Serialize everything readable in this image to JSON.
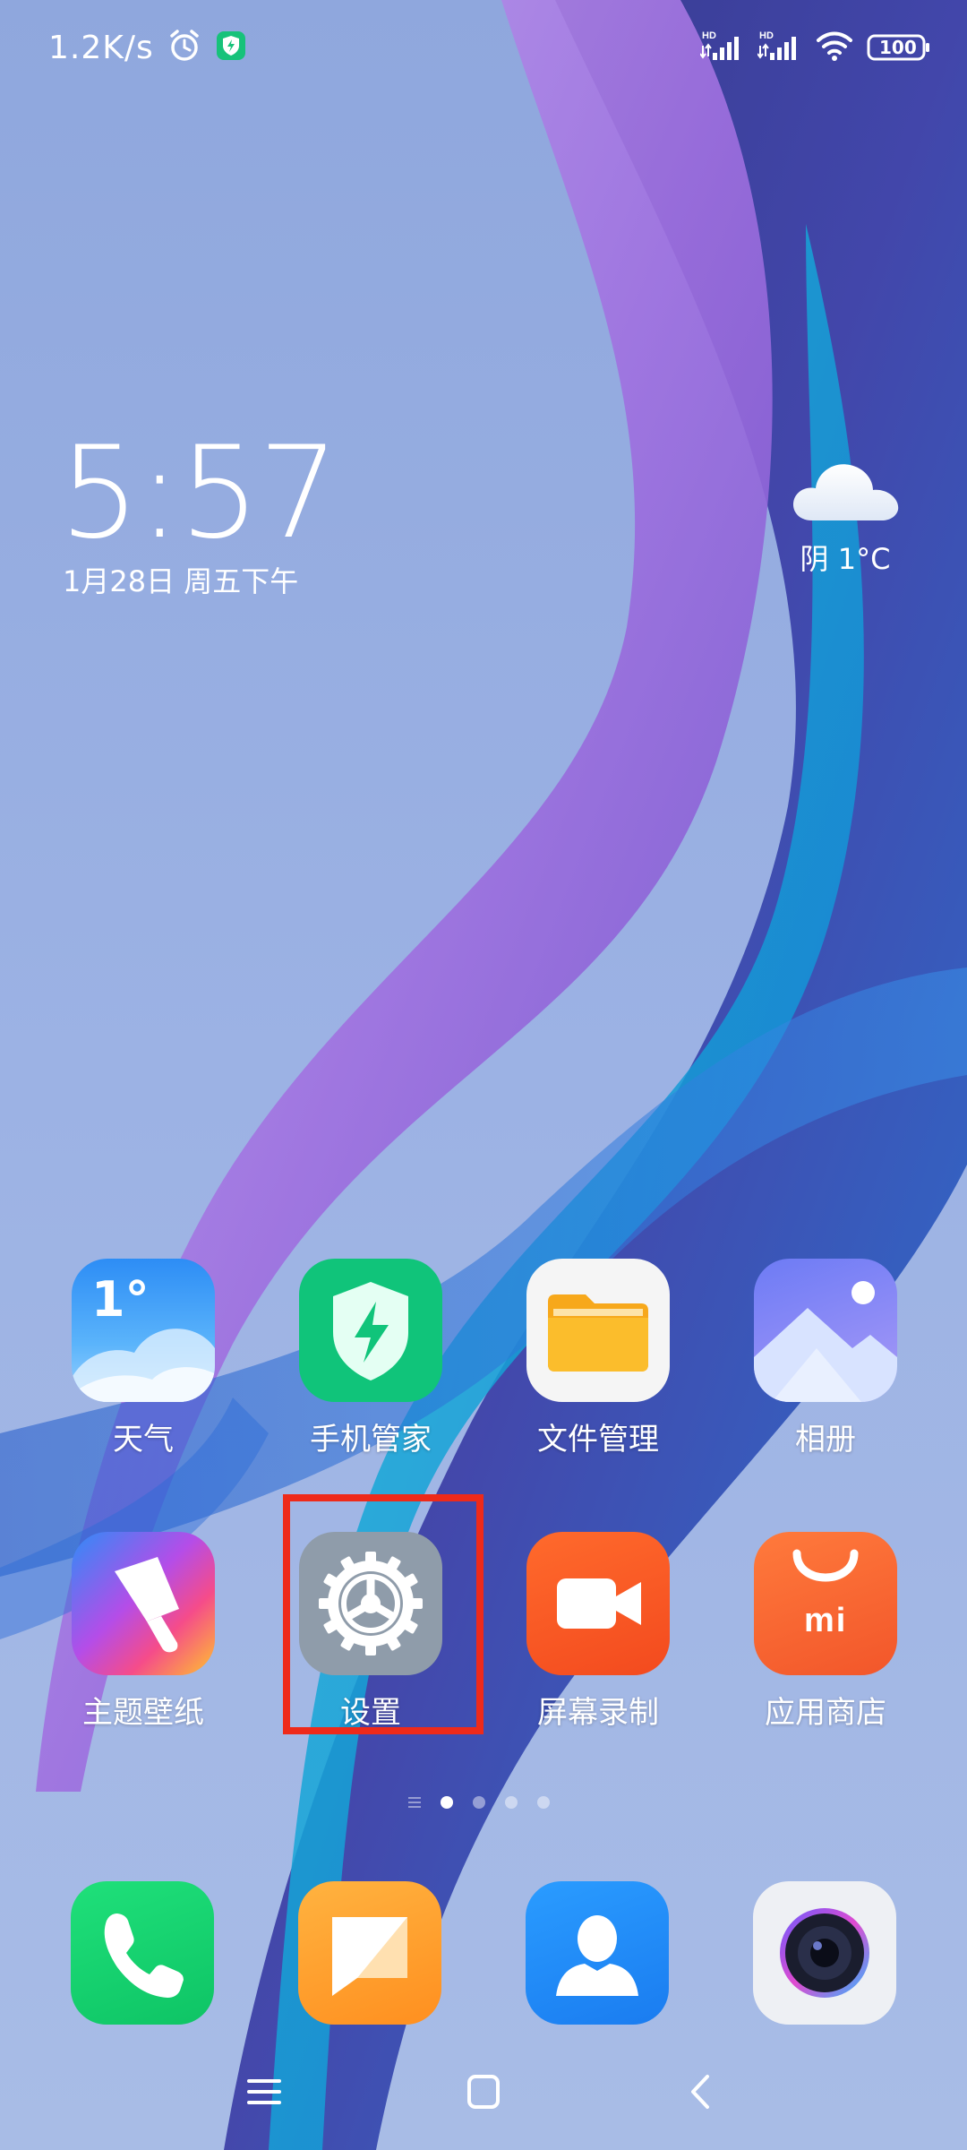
{
  "status_bar": {
    "net_speed": "1.2K/s",
    "signal1_label": "HD",
    "signal2_label": "HD",
    "battery": "100",
    "icons": [
      "alarm-icon",
      "security-shield-icon",
      "signal-icon",
      "signal-icon",
      "wifi-icon",
      "battery-icon"
    ]
  },
  "clock": {
    "time": "5:57",
    "date": "1月28日 周五下午"
  },
  "weather": {
    "condition_temp": "阴  1°C",
    "icon": "cloud-icon"
  },
  "apps": [
    {
      "label": "天气",
      "icon": "weather-icon",
      "badge": "1°"
    },
    {
      "label": "手机管家",
      "icon": "security-shield-bolt-icon"
    },
    {
      "label": "文件管理",
      "icon": "folder-icon"
    },
    {
      "label": "相册",
      "icon": "gallery-icon"
    },
    {
      "label": "主题壁纸",
      "icon": "theme-brush-icon"
    },
    {
      "label": "设置",
      "icon": "gear-icon"
    },
    {
      "label": "屏幕录制",
      "icon": "video-camera-icon"
    },
    {
      "label": "应用商店",
      "icon": "mi-store-bag-icon",
      "badge": "mi"
    }
  ],
  "dock": [
    {
      "icon": "phone-icon"
    },
    {
      "icon": "message-icon"
    },
    {
      "icon": "contacts-icon"
    },
    {
      "icon": "camera-icon"
    }
  ],
  "page_indicator": {
    "pages": 4,
    "current": 1
  },
  "nav": [
    "menu-icon",
    "home-icon",
    "back-icon"
  ],
  "colors": {
    "highlight": "#ee2a1a",
    "background": "#97aee2"
  }
}
